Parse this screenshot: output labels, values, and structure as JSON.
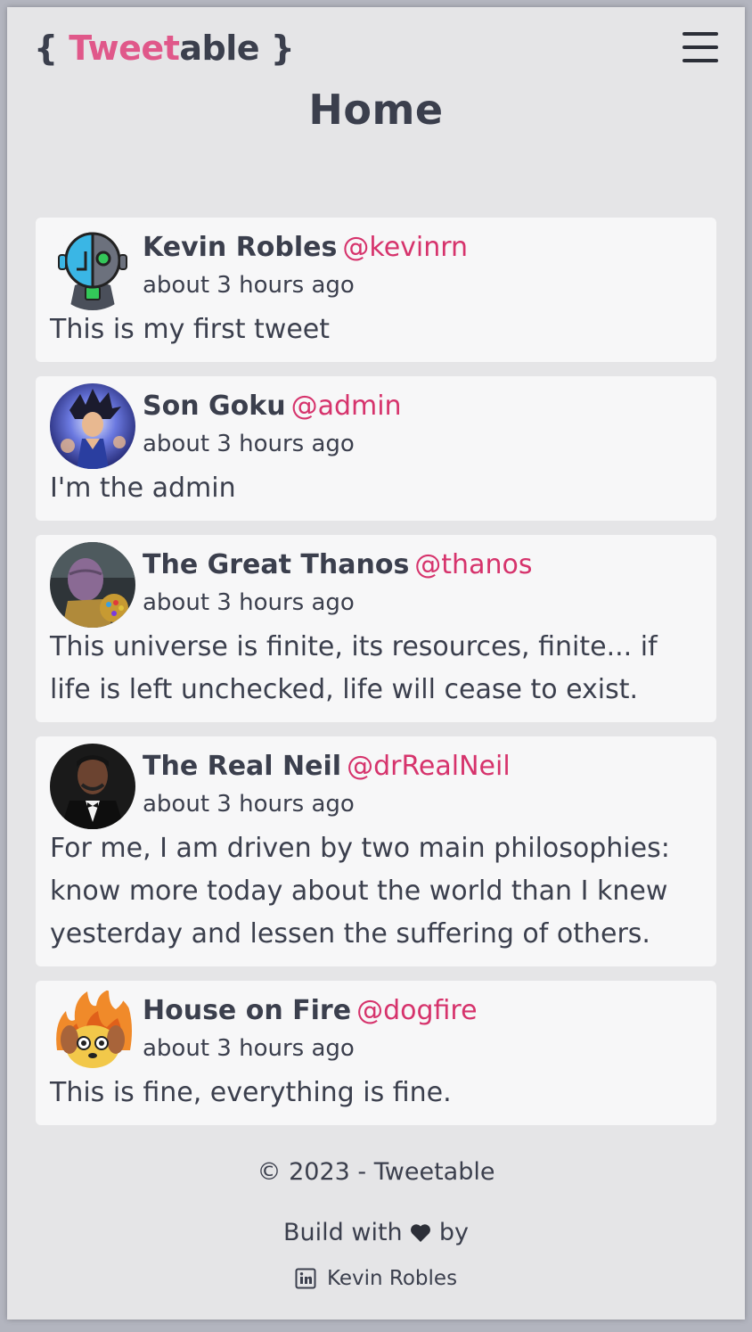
{
  "header": {
    "logo_open": "{ ",
    "logo_pink": "Tweet",
    "logo_dark": "able",
    "logo_close": " }",
    "menu_icon": "hamburger-icon",
    "title": "Home"
  },
  "tweets": [
    {
      "name": "Kevin Robles",
      "handle": "@kevinrn",
      "time": "about 3 hours ago",
      "content": "This is my first tweet",
      "avatar": "robot-avatar"
    },
    {
      "name": "Son Goku",
      "handle": "@admin",
      "time": "about 3 hours ago",
      "content": "I'm the admin",
      "avatar": "goku-avatar"
    },
    {
      "name": "The Great Thanos",
      "handle": "@thanos",
      "time": "about 3 hours ago",
      "content": "This universe is finite, its resources, finite... if life is left unchecked, life will cease to exist.",
      "avatar": "thanos-avatar"
    },
    {
      "name": "The Real Neil",
      "handle": "@drRealNeil",
      "time": "about 3 hours ago",
      "content": "For me, I am driven by two main philosophies: know more today about the world than I knew yesterday and lessen the suffering of others.",
      "avatar": "neil-avatar"
    },
    {
      "name": "House on Fire",
      "handle": "@dogfire",
      "time": "about 3 hours ago",
      "content": "This is fine, everything is fine.",
      "avatar": "dog-fire-avatar"
    }
  ],
  "footer": {
    "copyright": "© 2023 - Tweetable",
    "build_prefix": "Build with",
    "build_suffix": "by",
    "author": "Kevin Robles",
    "heart_icon": "heart-icon",
    "linkedin_icon": "linkedin-icon"
  },
  "colors": {
    "accent": "#d6336c",
    "logo_pink": "#e0588a",
    "text": "#3b3f4d",
    "card": "#f7f7f8",
    "background": "#e5e5e7"
  }
}
